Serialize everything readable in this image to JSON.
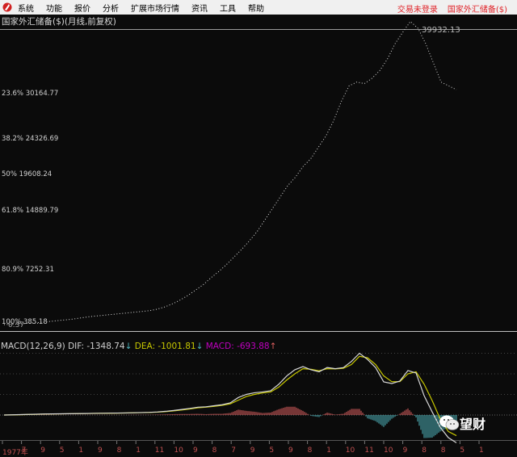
{
  "menubar": {
    "items": [
      "系统",
      "功能",
      "报价",
      "分析",
      "扩展市场行情",
      "资讯",
      "工具",
      "帮助"
    ],
    "login": "交易未登录",
    "instrument": "国家外汇储备($)"
  },
  "chart_title": "国家外汇储备($)(月线,前复权)",
  "peak_label": "39932.13",
  "low_label": "0.37",
  "fib_levels": [
    {
      "label": "23.6% 30164.77",
      "value": 30164.77
    },
    {
      "label": "38.2% 24326.69",
      "value": 24326.69
    },
    {
      "label": "50% 19608.24",
      "value": 19608.24
    },
    {
      "label": "61.8% 14889.79",
      "value": 14889.79
    },
    {
      "label": "80.9% 7252.31",
      "value": 7252.31
    },
    {
      "label": "100% 385.18",
      "value": 385.18
    }
  ],
  "macd": {
    "name": "MACD(12,26,9)",
    "dif": "DIF: -1348.74",
    "dea": "DEA: -1001.81",
    "macd": "MACD: -693.88",
    "colors": {
      "dif": "#d8d8d8",
      "dea": "#c8c800",
      "macd": "#c000c0",
      "up": "#e06060",
      "down": "#50b8c0"
    }
  },
  "chart_data": {
    "type": "line",
    "price": [
      385,
      420,
      480,
      550,
      620,
      700,
      800,
      900,
      1000,
      1100,
      1250,
      1400,
      1500,
      1600,
      1700,
      1800,
      1900,
      2000,
      2100,
      2200,
      2400,
      2700,
      3100,
      3600,
      4200,
      4900,
      5600,
      6500,
      7300,
      8200,
      9200,
      10200,
      11300,
      12500,
      14000,
      15500,
      17000,
      18500,
      19600,
      21000,
      22000,
      23500,
      25000,
      27000,
      29500,
      31500,
      32000,
      31800,
      32500,
      33500,
      35000,
      37000,
      38500,
      39900,
      39000,
      37000,
      34500,
      32000,
      31500,
      31000
    ],
    "dif": [
      0,
      10,
      20,
      30,
      40,
      50,
      55,
      60,
      65,
      70,
      75,
      80,
      85,
      90,
      95,
      100,
      110,
      120,
      130,
      150,
      180,
      220,
      270,
      320,
      380,
      400,
      450,
      500,
      590,
      850,
      1000,
      1080,
      1120,
      1180,
      1490,
      1900,
      2200,
      2350,
      2200,
      2100,
      2310,
      2250,
      2300,
      2600,
      3000,
      2700,
      2300,
      1610,
      1530,
      1650,
      2160,
      2040,
      940,
      150,
      -600,
      -1100,
      -1348.74
    ],
    "dea": [
      0,
      5,
      15,
      25,
      35,
      45,
      52,
      57,
      62,
      67,
      72,
      77,
      82,
      87,
      92,
      97,
      105,
      115,
      125,
      140,
      165,
      200,
      245,
      295,
      350,
      380,
      420,
      470,
      540,
      720,
      900,
      1000,
      1070,
      1120,
      1350,
      1700,
      2000,
      2250,
      2220,
      2150,
      2250,
      2240,
      2270,
      2450,
      2850,
      2780,
      2450,
      1900,
      1620,
      1620,
      2000,
      2100,
      1500,
      700,
      -200,
      -800,
      -1001.81
    ],
    "x_labels": [
      "1977年",
      "7",
      "9",
      "5",
      "1",
      "9",
      "8",
      "1",
      "11",
      "10",
      "9",
      "8",
      "7",
      "9",
      "5",
      "9",
      "8",
      "1",
      "10",
      "11",
      "10",
      "9",
      "8",
      "8",
      "5",
      "1"
    ]
  },
  "watermark": "望财"
}
